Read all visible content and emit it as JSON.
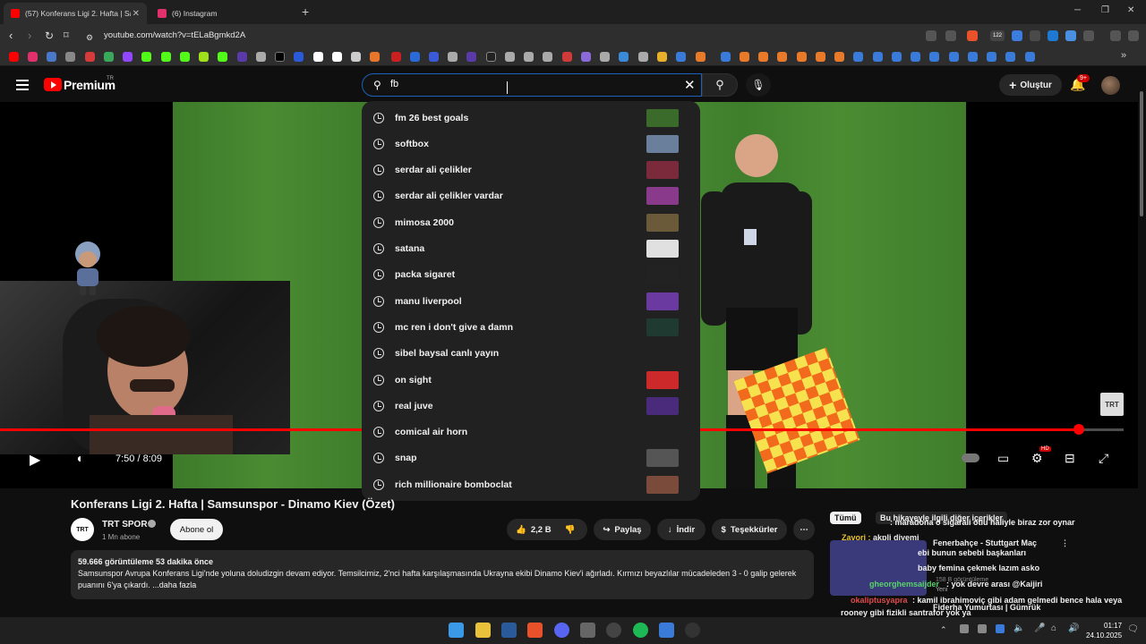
{
  "browser": {
    "tabs": [
      {
        "title": "(57) Konferans Ligi 2. Hafta | Sam",
        "active": true,
        "favicon_color": "#ff0000"
      },
      {
        "title": "(6) Instagram",
        "active": false,
        "favicon_color": "#e1306c"
      }
    ],
    "url": "youtube.com/watch?v=tELaBgmkd2A",
    "extension_badge": "122"
  },
  "youtube": {
    "logo_text": "Premium",
    "logo_region": "TR",
    "search_value": "fb",
    "create_label": "Oluştur",
    "notifications_badge": "9+"
  },
  "suggestions": [
    {
      "text": "fm 26 best goals",
      "thumb": "#3b6b2a"
    },
    {
      "text": "softbox",
      "thumb": "#6a7f9c"
    },
    {
      "text": "serdar ali çelikler",
      "thumb": "#7a2a3a"
    },
    {
      "text": "serdar ali çelikler vardar",
      "thumb": "#8a3a8a"
    },
    {
      "text": "mimosa 2000",
      "thumb": "#6b5a3a"
    },
    {
      "text": "satana",
      "thumb": "#e0e0e0"
    },
    {
      "text": "packa sigaret",
      "thumb": "#222222"
    },
    {
      "text": "manu liverpool",
      "thumb": "#6a3aa0"
    },
    {
      "text": "mc ren i don't give a damn",
      "thumb": "#1f3a30"
    },
    {
      "text": "sibel baysal canlı yayın",
      "thumb": ""
    },
    {
      "text": "on sight",
      "thumb": "#cc2a2a"
    },
    {
      "text": "real juve",
      "thumb": "#4a2a7a"
    },
    {
      "text": "comical air horn",
      "thumb": ""
    },
    {
      "text": "snap",
      "thumb": "#555555"
    },
    {
      "text": "rich millionaire bomboclat",
      "thumb": "#7a4a3a"
    }
  ],
  "player": {
    "time": "7:50 / 8:09",
    "progress": 0.9598,
    "watermark": "TRT"
  },
  "video": {
    "title": "Konferans Ligi 2. Hafta | Samsunspor - Dinamo Kiev (Özet)",
    "channel": "TRT SPOR",
    "channel_avatar": "TRT",
    "subscribers": "1 Mn abone",
    "subscribe_label": "Abone ol",
    "likes": "2,2 B",
    "share_label": "Paylaş",
    "download_label": "İndir",
    "thanks_label": "Teşekkürler",
    "views_date": "59.666 görüntüleme  53 dakika önce",
    "description": "Samsunspor Avrupa Konferans Ligi'nde yoluna doludizgin devam ediyor. Temsilcimiz, 2'nci hafta karşılaşmasında Ukrayna ekibi Dinamo Kiev'i ağırladı. Kırmızı beyazlılar mücadeleden 3 - 0 galip gelerek puanını 6'ya çıkardı. ...daha fazla"
  },
  "overlay": {
    "chip_all": "Tümü",
    "chip_related": "Bu hikayeyle ilgili diğer içerikler",
    "chat1_user": "Zavori :",
    "chat1_text": "akpli diyemi",
    "chat2_text": ": maradona o sigarali otlu haliyle biraz zor oynar",
    "rec1_title": "Fenerbahçe - Stuttgart Maç",
    "chat3_text": "ebi bunun sebebi başkanları",
    "chat4_text": "baby femina çekmek lazım asko",
    "chat5_user": "gheorghemsaijder",
    "chat5_text": ": yok devre arası @Kaijiri",
    "rec2_meta": "158 B görüntüleme",
    "chat6_user": "okaliptusyapra",
    "chat6_text": ": kamil ibrahimoviç gibi adam gelmedi bence hala veya",
    "chat7_text": "rooney gibi fizikli santrafor yok ya",
    "rec3_title": "Fiderha Yumurtası | Gümrük",
    "rec_new": "Yeni"
  },
  "taskbar": {
    "time": "01:17",
    "date": "24.10.2025"
  }
}
